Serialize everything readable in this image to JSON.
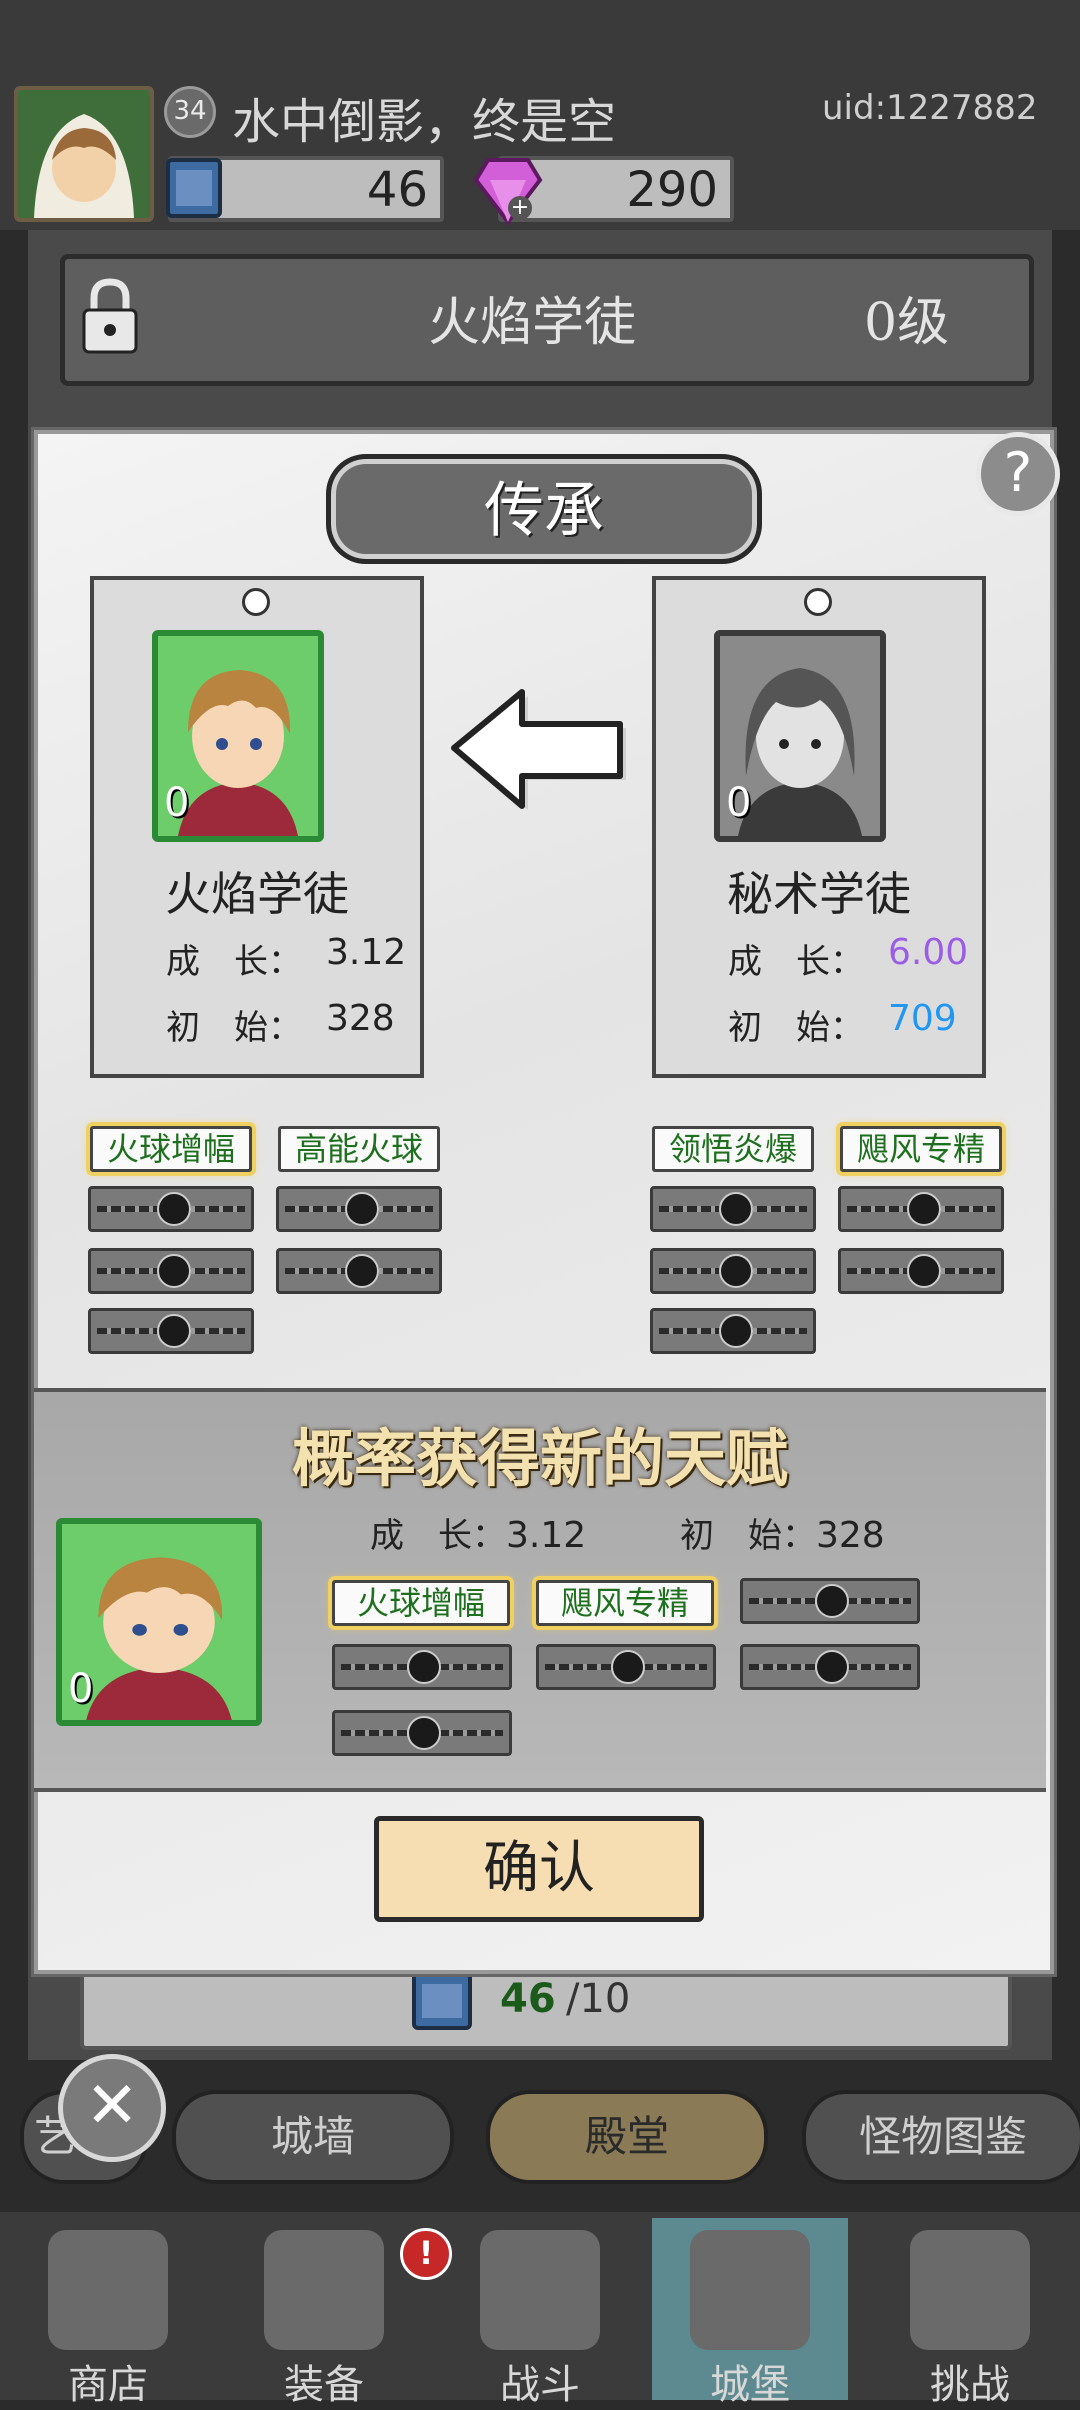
{
  "header": {
    "player_level": "34",
    "player_name": "水中倒影，终是空",
    "uid": "uid:1227882",
    "resources": {
      "books": "46",
      "gems": "290"
    }
  },
  "background_panel": {
    "locked_title": "火焰学徒",
    "locked_level": "0级",
    "count_current": "46",
    "count_max": "/10"
  },
  "popup": {
    "title": "传承",
    "help_label": "?",
    "left_card": {
      "name": "火焰学徒",
      "level": "0",
      "growth_label": "成　长：",
      "growth": "3.12",
      "initial_label": "初　始：",
      "initial": "328",
      "skills": [
        "火球增幅",
        "高能火球"
      ]
    },
    "right_card": {
      "name": "秘术学徒",
      "level": "0",
      "growth_label": "成　长：",
      "growth": "6.00",
      "initial_label": "初　始：",
      "initial": "709",
      "skills": [
        "领悟炎爆",
        "飓风专精"
      ]
    },
    "colors": {
      "growth_highlight": "#9b5de5",
      "initial_highlight": "#2196f3",
      "skill_text": "#1e6f1e"
    },
    "result": {
      "title": "概率获得新的天赋",
      "level": "0",
      "growth_label": "成　长：",
      "growth": "3.12",
      "initial_label": "初　始：",
      "initial": "328",
      "skills": [
        "火球增幅",
        "飓风专精"
      ]
    },
    "confirm_label": "确认"
  },
  "tabs": {
    "partial": "艺",
    "wall": "城墙",
    "hall": "殿堂",
    "monster": "怪物图鉴",
    "close_label": "✕"
  },
  "nav": {
    "shop": "商店",
    "equipment": "装备",
    "battle": "战斗",
    "castle": "城堡",
    "challenge": "挑战",
    "badge": "!"
  }
}
